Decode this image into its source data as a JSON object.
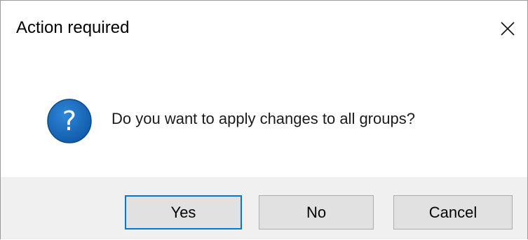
{
  "window": {
    "title": "Action required"
  },
  "dialog": {
    "icon": "question-icon",
    "message": "Do you want to apply changes to all groups?"
  },
  "buttons": {
    "yes_label": "Yes",
    "no_label": "No",
    "cancel_label": "Cancel",
    "default": "yes"
  },
  "colors": {
    "accent": "#0078d7",
    "icon_fill": "#1565b7",
    "footer_bg": "#f0f0f0",
    "button_bg": "#e1e1e1"
  }
}
